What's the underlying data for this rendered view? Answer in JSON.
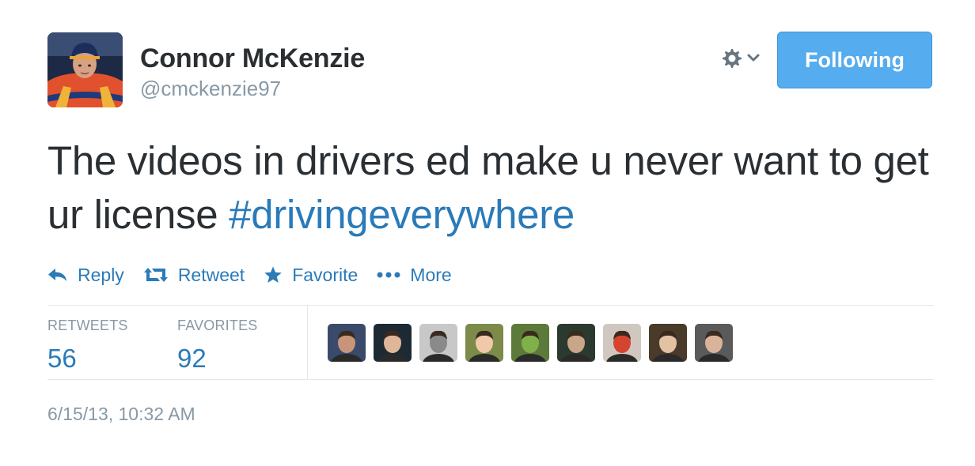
{
  "author": {
    "fullname": "Connor McKenzie",
    "username": "@cmckenzie97"
  },
  "header": {
    "follow_button_label": "Following"
  },
  "tweet": {
    "text": "The videos in drivers ed make u never want to get ur license ",
    "hashtag": "#drivingeverywhere"
  },
  "actions": {
    "reply_label": "Reply",
    "retweet_label": "Retweet",
    "favorite_label": "Favorite",
    "more_label": "More"
  },
  "stats": {
    "retweets_label": "RETWEETS",
    "retweets_count": "56",
    "favorites_label": "FAVORITES",
    "favorites_count": "92"
  },
  "favoriters": [
    {
      "name": "avatar-1",
      "bg": "#3a4a6a",
      "skin": "#c9957a"
    },
    {
      "name": "avatar-2",
      "bg": "#1e2a33",
      "skin": "#e0b69a"
    },
    {
      "name": "avatar-3",
      "bg": "#c8c8c8",
      "skin": "#8a8a8a"
    },
    {
      "name": "avatar-4",
      "bg": "#7c8a4a",
      "skin": "#f0c9a8"
    },
    {
      "name": "avatar-5",
      "bg": "#5c7a3a",
      "skin": "#7fb04a"
    },
    {
      "name": "avatar-6",
      "bg": "#2a3a2e",
      "skin": "#c9a58a"
    },
    {
      "name": "avatar-7",
      "bg": "#d0c8c0",
      "skin": "#d4442e"
    },
    {
      "name": "avatar-8",
      "bg": "#4a3a2a",
      "skin": "#e3c2a4"
    },
    {
      "name": "avatar-9",
      "bg": "#5a5a5a",
      "skin": "#d9b49a"
    }
  ],
  "timestamp": "6/15/13, 10:32 AM",
  "colors": {
    "link": "#2b7bb9",
    "follow_button": "#55acee",
    "muted": "#8899a6",
    "text": "#292f33"
  },
  "icons": {
    "gear": "gear-icon",
    "dropdown": "chevron-down-icon",
    "reply": "reply-icon",
    "retweet": "retweet-icon",
    "favorite": "star-icon",
    "more": "ellipsis-icon"
  }
}
